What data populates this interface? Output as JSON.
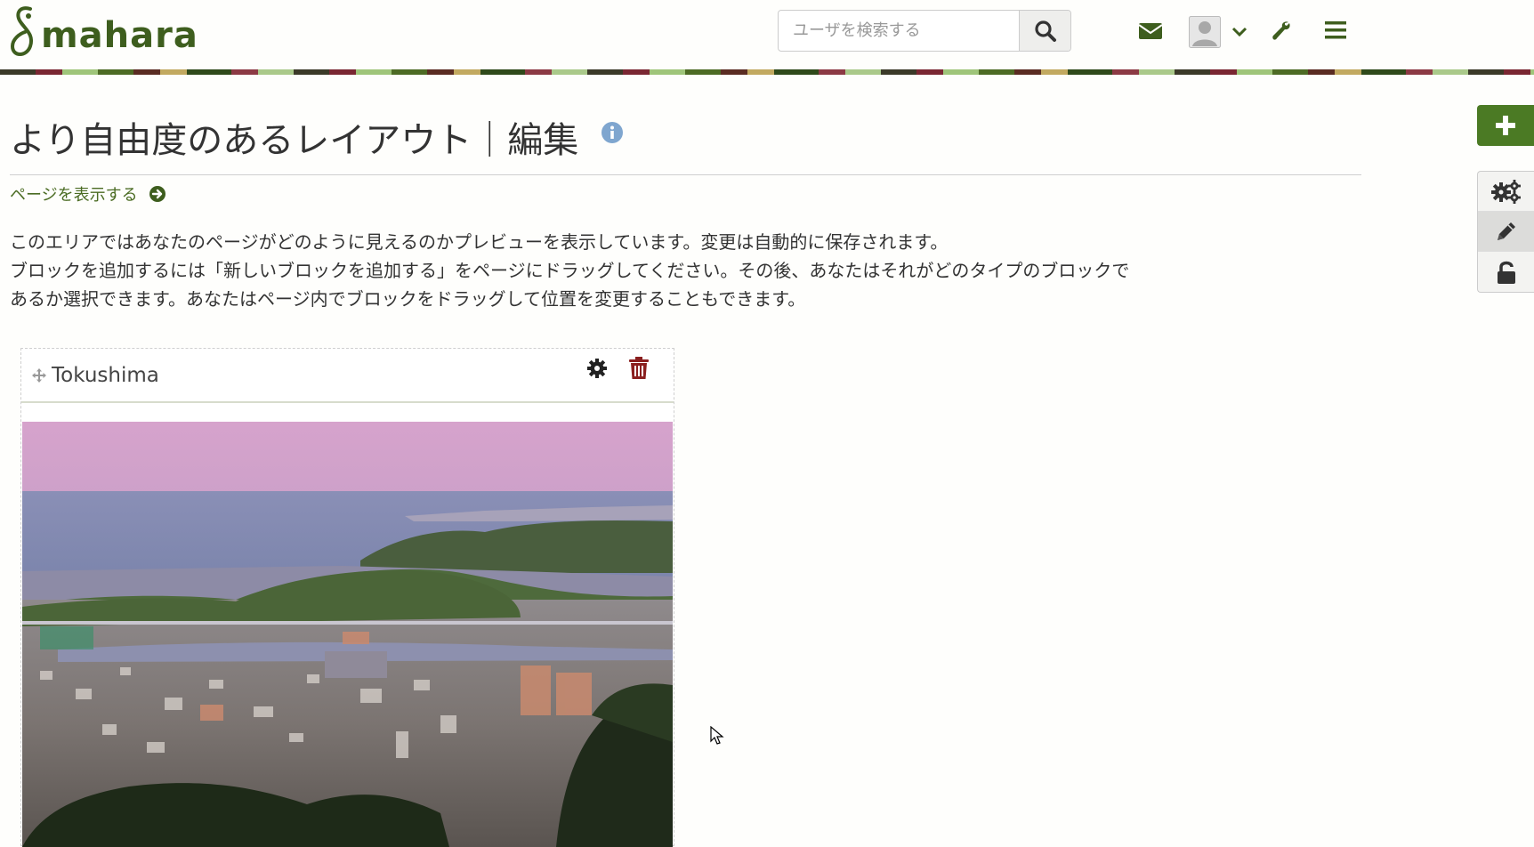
{
  "header": {
    "logo_text": "mahara",
    "search": {
      "placeholder": "ユーザを検索する",
      "value": ""
    },
    "icons": [
      "search-icon",
      "envelope-icon",
      "avatar",
      "chevron-down-icon",
      "wrench-icon",
      "hamburger-menu-icon"
    ]
  },
  "page": {
    "title": "より自由度のあるレイアウト｜編集",
    "view_link": "ページを表示する",
    "description": [
      "このエリアではあなたのページがどのように見えるのかプレビューを表示しています。変更は自動的に保存されます。",
      "ブロックを追加するには「新しいブロックを追加する」をページにドラッグしてください。その後、あなたはそれがどのタイプのブロックで",
      "あるか選択できます。あなたはページ内でブロックをドラッグして位置を変更することもできます。"
    ]
  },
  "block": {
    "title": "Tokushima",
    "image_description": "Tokushima city skyline at dusk"
  },
  "tools": {
    "items": [
      "plus-icon",
      "cogs-icon",
      "pencil-icon",
      "unlock-icon"
    ],
    "active": "pencil-icon"
  },
  "colors": {
    "brand_green": "#3e5e1e",
    "button_green": "#4b7a24",
    "link_green": "#4a6b22",
    "info_blue": "#7fa6cf",
    "trash_red": "#8a1f1f"
  }
}
